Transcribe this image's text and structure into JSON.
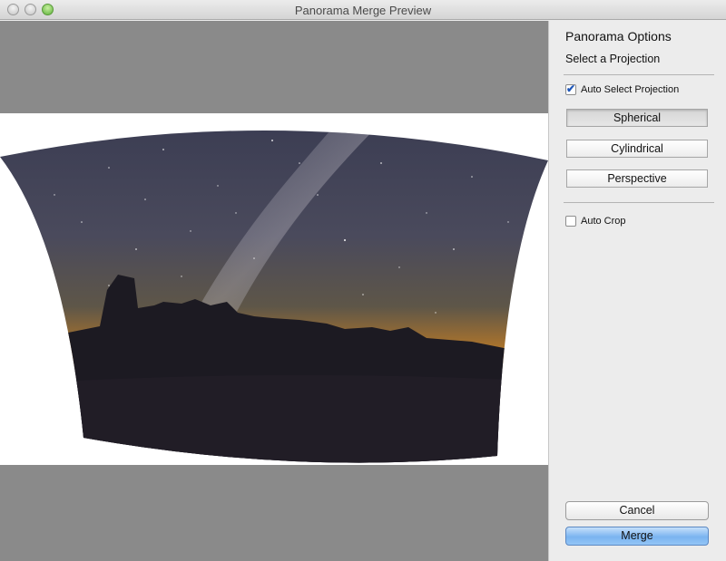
{
  "window": {
    "title": "Panorama Merge Preview"
  },
  "panel": {
    "title": "Panorama Options",
    "subtitle": "Select a Projection",
    "auto_select_label": "Auto Select Projection",
    "auto_select_checked": true,
    "projections": [
      {
        "label": "Spherical",
        "selected": true
      },
      {
        "label": "Cylindrical",
        "selected": false
      },
      {
        "label": "Perspective",
        "selected": false
      }
    ],
    "auto_crop_label": "Auto Crop",
    "auto_crop_checked": false,
    "cancel_label": "Cancel",
    "merge_label": "Merge"
  },
  "colors": {
    "accent": "#7ab4f0",
    "preview_background": "#8a8a8a",
    "sky_top": "#3c3a4e",
    "horizon_glow": "#c8862a"
  }
}
